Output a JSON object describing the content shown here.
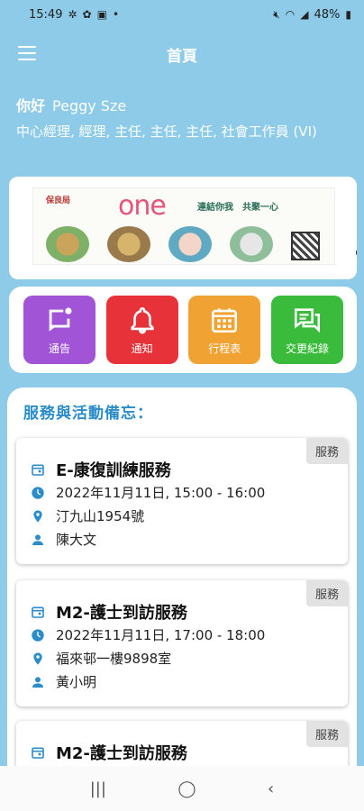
{
  "status_bar": {
    "time": "15:49",
    "battery": "48%"
  },
  "app_bar": {
    "title": "首頁",
    "menu_icon": "hamburger-icon"
  },
  "greeting": {
    "hello": "你好",
    "name": "Peggy Sze",
    "roles": "中心經理, 經理, 主任, 主任, 主任, 社會工作員 (VI)"
  },
  "banner": {
    "logo_text": "保良局",
    "brand": "one",
    "slogan": "連結你我　共聚一心"
  },
  "quick_actions": [
    {
      "label": "通告",
      "icon": "message-icon",
      "color": "#a155d6"
    },
    {
      "label": "通知",
      "icon": "bell-icon",
      "color": "#e8323a"
    },
    {
      "label": "行程表",
      "icon": "calendar-icon",
      "color": "#f0a232"
    },
    {
      "label": "交更紀錄",
      "icon": "chat-icon",
      "color": "#3bbb3b"
    }
  ],
  "memo": {
    "title": "服務與活動備忘：",
    "cards": [
      {
        "tag": "服務",
        "title": "E-康復訓練服務",
        "datetime": "2022年11月11日, 15:00 - 16:00",
        "location": "汀九山1954號",
        "person": "陳大文"
      },
      {
        "tag": "服務",
        "title": "M2-護士到訪服務",
        "datetime": "2022年11月11日, 17:00 - 18:00",
        "location": "福來邨一樓9898室",
        "person": "黃小明"
      },
      {
        "tag": "服務",
        "title": "M2-護士到訪服務"
      }
    ]
  },
  "colors": {
    "background": "#8dcbe8",
    "accent_blue": "#2a8cc8"
  }
}
